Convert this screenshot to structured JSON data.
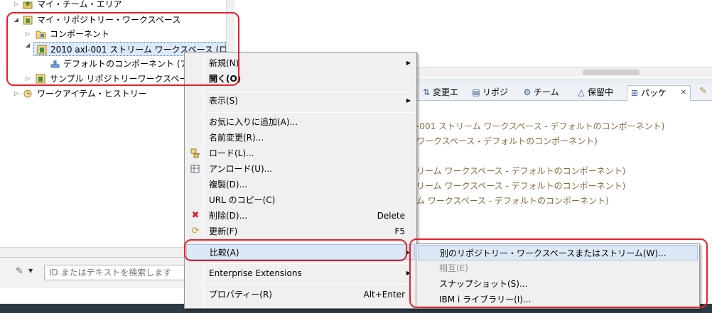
{
  "tree": {
    "items": [
      {
        "label": "マイ・チーム・エリア",
        "icon": "team-area-icon"
      },
      {
        "label": "マイ・リポジトリー・ワークスペース",
        "icon": "repository-workspace-icon"
      },
      {
        "label": "コンポーネント",
        "icon": "component-folder-icon"
      },
      {
        "label": "2010 axl-001 ストリーム ワークスペース (ロ",
        "icon": "workspace-icon"
      },
      {
        "label": "デフォルトのコンポーネント (ア",
        "icon": "component-icon"
      },
      {
        "label": "サンプル リポジトリーワークスペー",
        "icon": "workspace-icon"
      },
      {
        "label": "ワークアイテム・ヒストリー",
        "icon": "work-item-history-icon"
      }
    ]
  },
  "search": {
    "placeholder": "ID またはテキストを検索します"
  },
  "tabs": [
    {
      "label": "変更エ",
      "icon": "pending-changes-icon"
    },
    {
      "label": "リポジ",
      "icon": "repository-files-icon"
    },
    {
      "label": "チーム",
      "icon": "team-icon"
    },
    {
      "label": "保留中",
      "icon": "pending-icon"
    },
    {
      "label": "パッケ",
      "icon": "package-explorer-icon"
    },
    {
      "close": "✕"
    }
  ],
  "results": {
    "lines": [
      "-001 ストリーム ワークスペース - デフォルトのコンポーネント)",
      "ワークスペース - デフォルトのコンポーネント)",
      "リーム ワークスペース - デフォルトのコンポーネント)",
      "リーム ワークスペース - デフォルトのコンポーネント)",
      "ム ワークスペース - デフォルトのコンポーネント)"
    ]
  },
  "context_menu": {
    "items": [
      {
        "label": "新規(N)",
        "submenu": true
      },
      {
        "label": "開く(O)"
      },
      {
        "label": "表示(S)",
        "submenu": true
      },
      {
        "label": "お気に入りに追加(A)..."
      },
      {
        "label": "名前変更(R)..."
      },
      {
        "label": "ロード(L)...",
        "icon": "load-icon"
      },
      {
        "label": "アンロード(U)...",
        "icon": "unload-icon"
      },
      {
        "label": "複製(D)..."
      },
      {
        "label": "URL のコピー(C)"
      },
      {
        "label": "削除(D)...",
        "accelerator": "Delete",
        "icon": "delete-icon"
      },
      {
        "label": "更新(F)",
        "accelerator": "F5",
        "icon": "refresh-icon"
      },
      {
        "label": "比較(A)",
        "submenu": true,
        "highlighted": true
      },
      {
        "label": "Enterprise Extensions",
        "submenu": true
      },
      {
        "label": "プロパティー(R)",
        "accelerator": "Alt+Enter"
      }
    ],
    "submenu_arrow": "▶"
  },
  "compare_submenu": {
    "items": [
      {
        "label": "別のリポジトリー・ワークスペースまたはストリーム(W)...",
        "highlighted": true
      },
      {
        "label": "相互(E)",
        "disabled": true
      },
      {
        "label": "スナップショット(S)..."
      },
      {
        "label": "IBM i ライブラリー(I)..."
      }
    ]
  },
  "colors": {
    "annotation": "#e8202a",
    "result_text": "#8a6a3e",
    "highlight": "#dde8f6"
  }
}
